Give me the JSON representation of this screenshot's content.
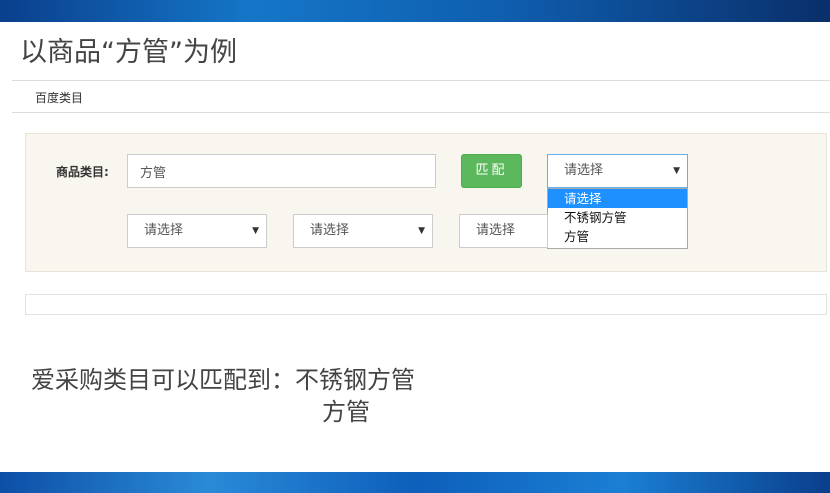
{
  "slide": {
    "title": "以商品“方管”为例"
  },
  "breadcrumb": "百度类目",
  "form": {
    "category_label": "商品类目:",
    "category_value": "方管",
    "match_button": "匹配",
    "select_main": "请选择",
    "select_1": "请选择",
    "select_2": "请选择",
    "select_3": "请选择",
    "dropdown_options": [
      "请选择",
      "不锈钢方管",
      "方管"
    ]
  },
  "caption": {
    "line1": "爱采购类目可以匹配到：不锈钢方管",
    "line2": "方管"
  },
  "colors": {
    "match_button": "#5cb85c",
    "selected_option": "#1e90ff",
    "panel_bg": "#f8f6ef",
    "banner": "#0f5fb0"
  }
}
